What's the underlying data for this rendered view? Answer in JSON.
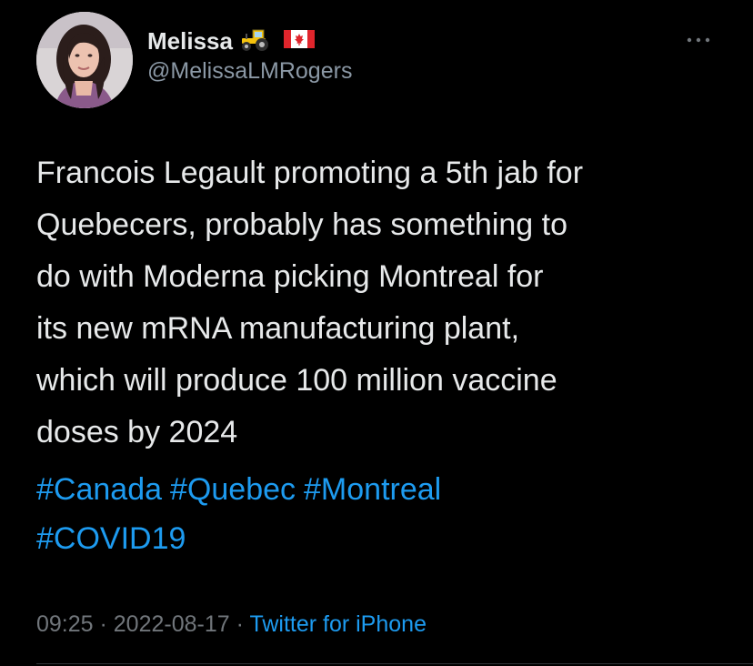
{
  "author": {
    "display_name": "Melissa",
    "handle": "@MelissaLMRogers",
    "badges": [
      "tractor-emoji",
      "canada-flag-emoji"
    ]
  },
  "menu_icon": "more-horizontal-icon",
  "tweet": {
    "lines": [
      "Francois Legault promoting a 5th jab for",
      "Quebecers, probably has something to",
      "do with Moderna picking Montreal for",
      "its new mRNA manufacturing plant,",
      "which will produce 100 million vaccine",
      "doses by 2024"
    ],
    "hashtag_lines": [
      [
        "#Canada",
        "#Quebec",
        "#Montreal"
      ],
      [
        "#COVID19"
      ]
    ]
  },
  "meta": {
    "time": "09:25",
    "separator": " · ",
    "date": "2022-08-17",
    "source": "Twitter for iPhone"
  },
  "colors": {
    "background": "#000000",
    "text": "#e7e9ea",
    "secondary": "#71767b",
    "link": "#1d9bf0"
  }
}
